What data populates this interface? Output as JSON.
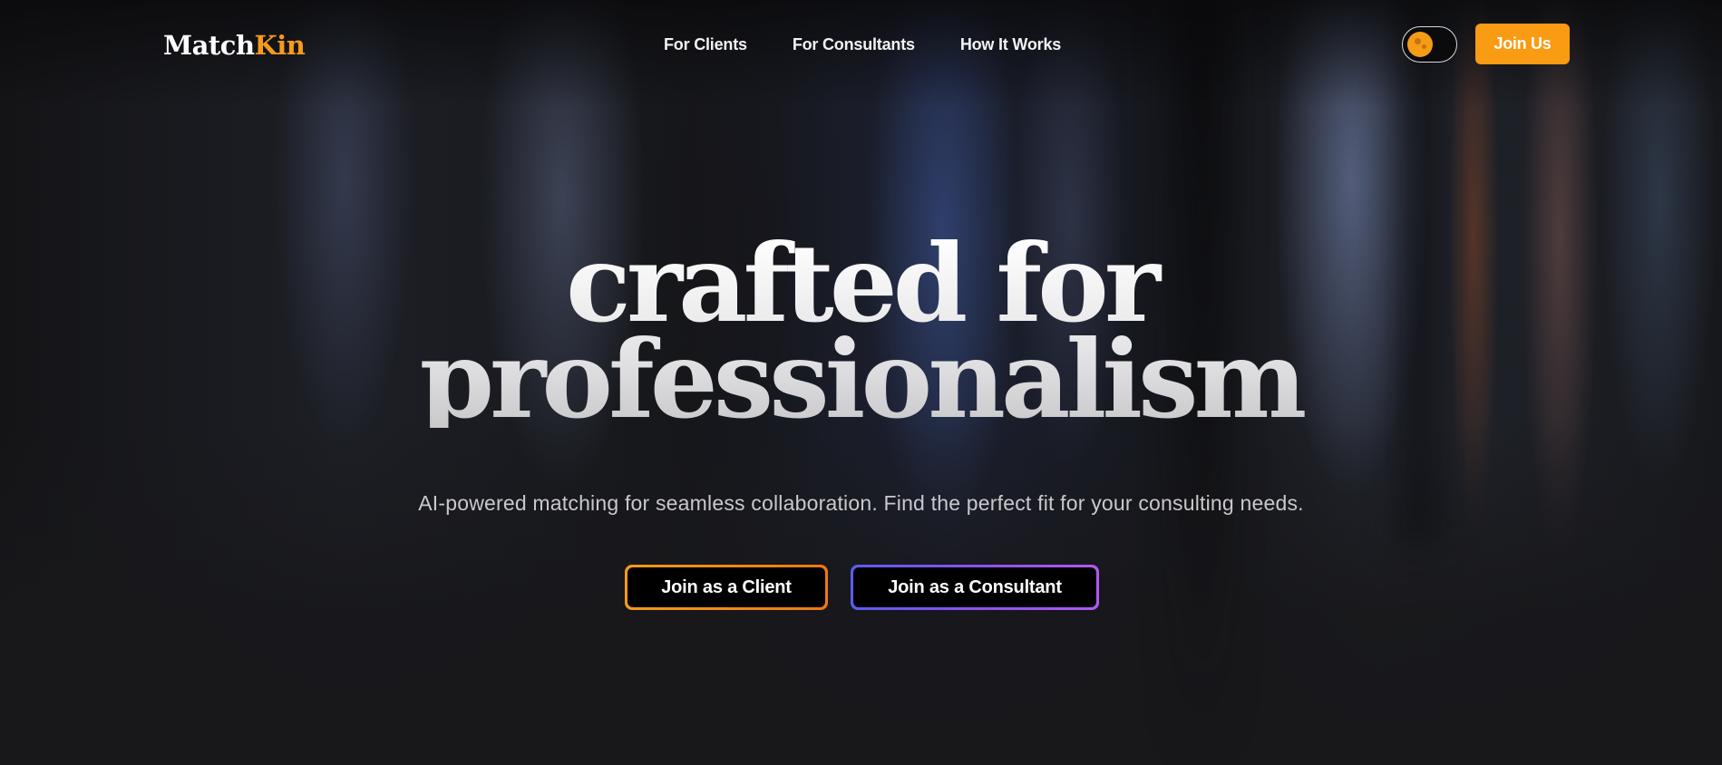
{
  "brand": {
    "name_part1": "Match",
    "name_part2": "Kin",
    "accent_color": "#f79a1c"
  },
  "nav": {
    "links": [
      {
        "label": "For Clients"
      },
      {
        "label": "For Consultants"
      },
      {
        "label": "How It Works"
      }
    ],
    "theme_toggle_icon": "sun-moon-toggle-icon",
    "join_label": "Join Us"
  },
  "hero": {
    "title_line1": "crafted for",
    "title_line2": "professionalism",
    "subtitle": "AI-powered matching for seamless collaboration. Find the perfect fit for your consulting needs.",
    "cta_client": "Join as a Client",
    "cta_consultant": "Join as a Consultant",
    "cta_client_border": "#f59a1a",
    "cta_consultant_border": "#8a52f0"
  }
}
